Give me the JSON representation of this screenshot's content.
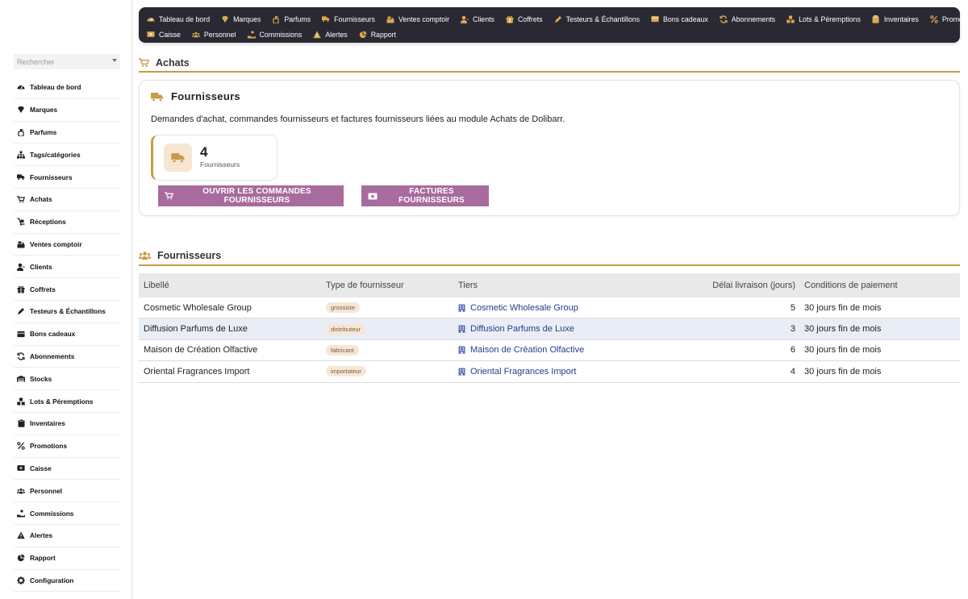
{
  "search": {
    "placeholder": "Rechercher"
  },
  "sidebar": {
    "items": [
      {
        "label": "Tableau de bord",
        "icon": "dashboard-icon"
      },
      {
        "label": "Marques",
        "icon": "gem-icon"
      },
      {
        "label": "Parfums",
        "icon": "perfume-icon"
      },
      {
        "label": "Tags/catégories",
        "icon": "sitemap-icon"
      },
      {
        "label": "Fournisseurs",
        "icon": "truck-icon"
      },
      {
        "label": "Achats",
        "icon": "cart-icon"
      },
      {
        "label": "Réceptions",
        "icon": "dolly-icon"
      },
      {
        "label": "Ventes comptoir",
        "icon": "cash-register-icon"
      },
      {
        "label": "Clients",
        "icon": "user-icon"
      },
      {
        "label": "Coffrets",
        "icon": "gift-icon"
      },
      {
        "label": "Testeurs & Échantillons",
        "icon": "pen-icon"
      },
      {
        "label": "Bons cadeaux",
        "icon": "card-icon"
      },
      {
        "label": "Abonnements",
        "icon": "sync-icon"
      },
      {
        "label": "Stocks",
        "icon": "warehouse-icon"
      },
      {
        "label": "Lots & Péremptions",
        "icon": "boxes-icon"
      },
      {
        "label": "Inventaires",
        "icon": "clipboard-icon"
      },
      {
        "label": "Promotions",
        "icon": "percent-icon"
      },
      {
        "label": "Caisse",
        "icon": "money-icon"
      },
      {
        "label": "Personnel",
        "icon": "users-icon"
      },
      {
        "label": "Commissions",
        "icon": "hand-coin-icon"
      },
      {
        "label": "Alertes",
        "icon": "warning-icon"
      },
      {
        "label": "Rapport",
        "icon": "chart-pie-icon"
      },
      {
        "label": "Configuration",
        "icon": "gear-icon"
      }
    ]
  },
  "topnav": {
    "row1": [
      {
        "label": "Tableau de bord",
        "icon": "dashboard-icon"
      },
      {
        "label": "Marques",
        "icon": "gem-icon"
      },
      {
        "label": "Parfums",
        "icon": "perfume-icon"
      },
      {
        "label": "Fournisseurs",
        "icon": "truck-icon"
      },
      {
        "label": "Ventes comptoir",
        "icon": "cash-register-icon"
      },
      {
        "label": "Clients",
        "icon": "user-icon"
      },
      {
        "label": "Coffrets",
        "icon": "gift-icon"
      },
      {
        "label": "Testeurs & Échantillons",
        "icon": "pen-icon"
      },
      {
        "label": "Bons cadeaux",
        "icon": "card-icon"
      },
      {
        "label": "Abonnements",
        "icon": "sync-icon"
      },
      {
        "label": "Lots & Péremptions",
        "icon": "boxes-icon"
      },
      {
        "label": "Inventaires",
        "icon": "clipboard-icon"
      },
      {
        "label": "Promotions",
        "icon": "percent-icon"
      }
    ],
    "row2": [
      {
        "label": "Caisse",
        "icon": "money-icon"
      },
      {
        "label": "Personnel",
        "icon": "users-icon"
      },
      {
        "label": "Commissions",
        "icon": "hand-coin-icon"
      },
      {
        "label": "Alertes",
        "icon": "warning-icon"
      },
      {
        "label": "Rapport",
        "icon": "chart-pie-icon"
      }
    ]
  },
  "main": {
    "section_title": "Achats",
    "card": {
      "title": "Fournisseurs",
      "description": "Demandes d'achat, commandes fournisseurs et factures fournisseurs liées au module Achats de Dolibarr.",
      "stat_value": "4",
      "stat_label": "Fournisseurs",
      "btn_orders": "OUVRIR LES COMMANDES FOURNISSEURS",
      "btn_invoices": "FACTURES FOURNISSEURS"
    },
    "list_title": "Fournisseurs",
    "table": {
      "headers": [
        "Libellé",
        "Type de fournisseur",
        "Tiers",
        "Délai livraison (jours)",
        "Conditions de paiement"
      ],
      "rows": [
        {
          "libelle": "Cosmetic Wholesale Group",
          "type": "grossiste",
          "tiers": "Cosmetic Wholesale Group",
          "delai": "5",
          "conditions": "30 jours fin de mois"
        },
        {
          "libelle": "Diffusion Parfums de Luxe",
          "type": "distributeur",
          "tiers": "Diffusion Parfums de Luxe",
          "delai": "3",
          "conditions": "30 jours fin de mois"
        },
        {
          "libelle": "Maison de Création Olfactive",
          "type": "fabricant",
          "tiers": "Maison de Création Olfactive",
          "delai": "6",
          "conditions": "30 jours fin de mois"
        },
        {
          "libelle": "Oriental Fragrances Import",
          "type": "importateur",
          "tiers": "Oriental Fragrances Import",
          "delai": "4",
          "conditions": "30 jours fin de mois"
        }
      ]
    }
  },
  "colors": {
    "accent": "#c89b44",
    "button": "#a86b9d",
    "nav_bg": "#2a2833",
    "link": "#263c8a",
    "row_alt": "#e9eef6"
  }
}
